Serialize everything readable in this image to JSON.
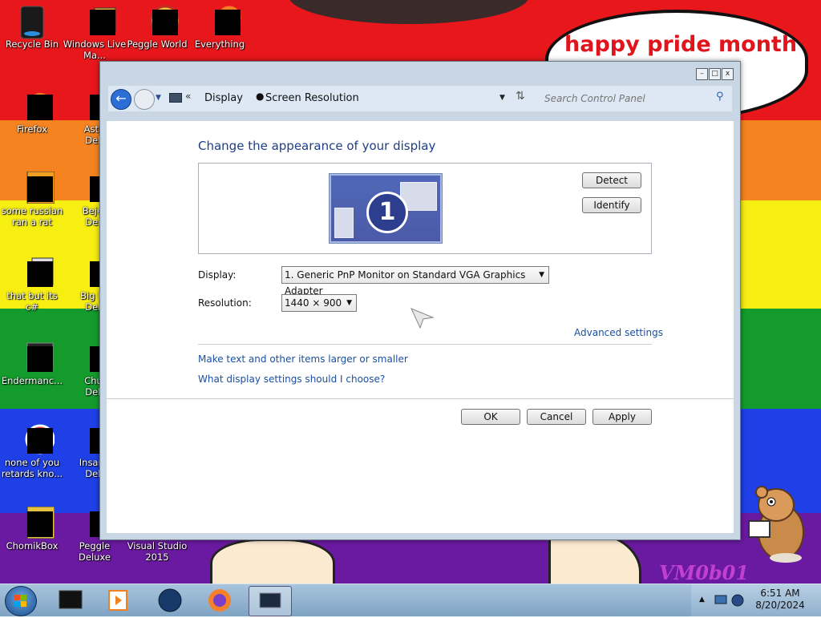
{
  "desktop": {
    "bubble_text": "happy pride month",
    "watermark": "VM0b01",
    "icons": [
      {
        "name": "Recycle Bin"
      },
      {
        "name": "Windows Live Ma..."
      },
      {
        "name": "Peggle World"
      },
      {
        "name": "Everything"
      },
      {
        "name": "Firefox"
      },
      {
        "name": "Astro... Delu..."
      },
      {
        "name": "some russian ran a rat"
      },
      {
        "name": "Bejew... Delu..."
      },
      {
        "name": "that but its c#"
      },
      {
        "name": "Big Mo... Delu..."
      },
      {
        "name": "Endermanc..."
      },
      {
        "name": "Chuz... Delu..."
      },
      {
        "name": "none of you retards kno..."
      },
      {
        "name": "Insaniq... Delu..."
      },
      {
        "name": "ChomikBox"
      },
      {
        "name": "Peggle Deluxe"
      },
      {
        "name": "Visual Studio 2015"
      }
    ]
  },
  "window": {
    "breadcrumb": {
      "root": "Display",
      "current": "Screen Resolution"
    },
    "search_placeholder": "Search Control Panel",
    "title_buttons": {
      "min": "–",
      "max": "□",
      "close": "x"
    },
    "heading": "Change the appearance of your display",
    "monitor_number": "1",
    "detect": "Detect",
    "identify": "Identify",
    "display_label": "Display:",
    "display_value": "1. Generic PnP Monitor on Standard VGA Graphics Adapter",
    "resolution_label": "Resolution:",
    "resolution_value": "1440 × 900",
    "advanced": "Advanced settings",
    "link_text_size": "Make text and other items larger or smaller",
    "link_what": "What display settings should I choose?",
    "ok": "OK",
    "cancel": "Cancel",
    "apply": "Apply"
  },
  "taskbar": {
    "time": "6:51 AM",
    "date": "8/20/2024"
  }
}
